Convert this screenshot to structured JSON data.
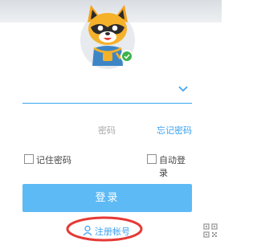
{
  "login": {
    "password_placeholder": "密码",
    "forgot_password": "忘记密码",
    "remember_password": "记住密码",
    "auto_login": "自动登录",
    "login_button": "登录",
    "register_account": "注册帐号"
  },
  "colors": {
    "accent": "#3aa0ef",
    "login_button": "#5dbaf5",
    "online_badge": "#3cb34a",
    "annotation_circle": "#e53935"
  },
  "icons": {
    "avatar": "raccoon-mascot-avatar",
    "online": "online-check-icon",
    "dropdown": "chevron-down-icon",
    "register": "user-icon",
    "qr": "qr-code-icon"
  }
}
